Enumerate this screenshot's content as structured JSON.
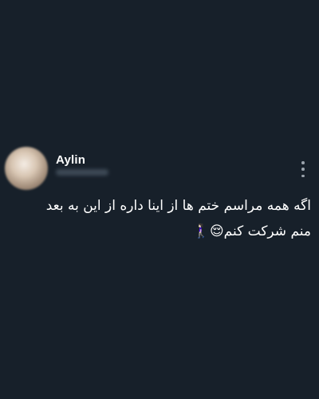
{
  "tweet": {
    "author_name": "Aylin",
    "text_line1": "اگه همه مراسم ختم ها از اینا داره از این به بعد",
    "text_line2": "منم شرکت کنم😌🚶🏻‍♀️"
  },
  "icons": {
    "avatar": "blurred-profile-photo",
    "handle": "blurred-username",
    "more": "vertical-ellipsis-icon"
  },
  "colors": {
    "background": "#17202a",
    "text": "#ffffff",
    "muted": "#9aa3ac"
  }
}
